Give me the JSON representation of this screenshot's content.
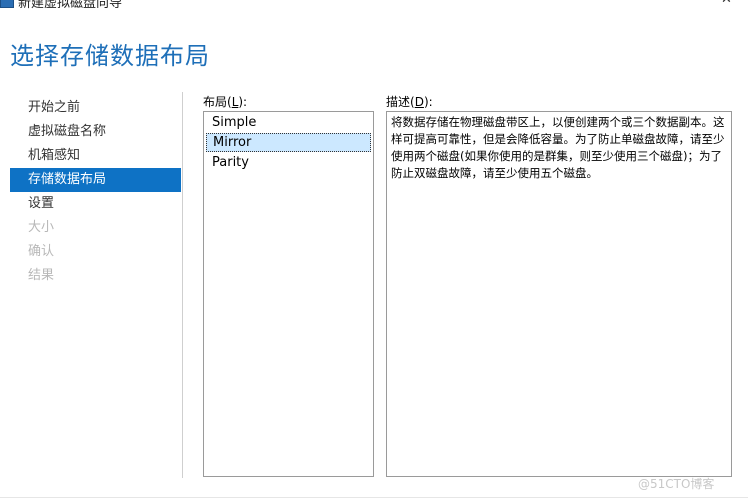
{
  "window": {
    "title": "新建虚拟磁盘向导",
    "minimize_glyph": "—",
    "close_glyph": "✕"
  },
  "page_title": "选择存储数据布局",
  "nav": {
    "items": [
      {
        "label": "开始之前",
        "state": "normal"
      },
      {
        "label": "虚拟磁盘名称",
        "state": "normal"
      },
      {
        "label": "机箱感知",
        "state": "normal"
      },
      {
        "label": "存储数据布局",
        "state": "active"
      },
      {
        "label": "设置",
        "state": "normal"
      },
      {
        "label": "大小",
        "state": "disabled"
      },
      {
        "label": "确认",
        "state": "disabled"
      },
      {
        "label": "结果",
        "state": "disabled"
      }
    ]
  },
  "layout": {
    "label": "布局(",
    "accesskey": "L",
    "label_end": "):",
    "options": [
      "Simple",
      "Mirror",
      "Parity"
    ],
    "selected": "Mirror"
  },
  "description": {
    "label": "描述(",
    "accesskey": "D",
    "label_end": "):",
    "text": "将数据存储在物理磁盘带区上，以便创建两个或三个数据副本。这样可提高可靠性，但是会降低容量。为了防止单磁盘故障，请至少使用两个磁盘(如果你使用的是群集，则至少使用三个磁盘)；为了防止双磁盘故障，请至少使用五个磁盘。"
  },
  "watermark": "@51CTO博客",
  "colors": {
    "accent": "#0e72c5",
    "title": "#1e6fb8",
    "selection": "#cce8ff"
  }
}
